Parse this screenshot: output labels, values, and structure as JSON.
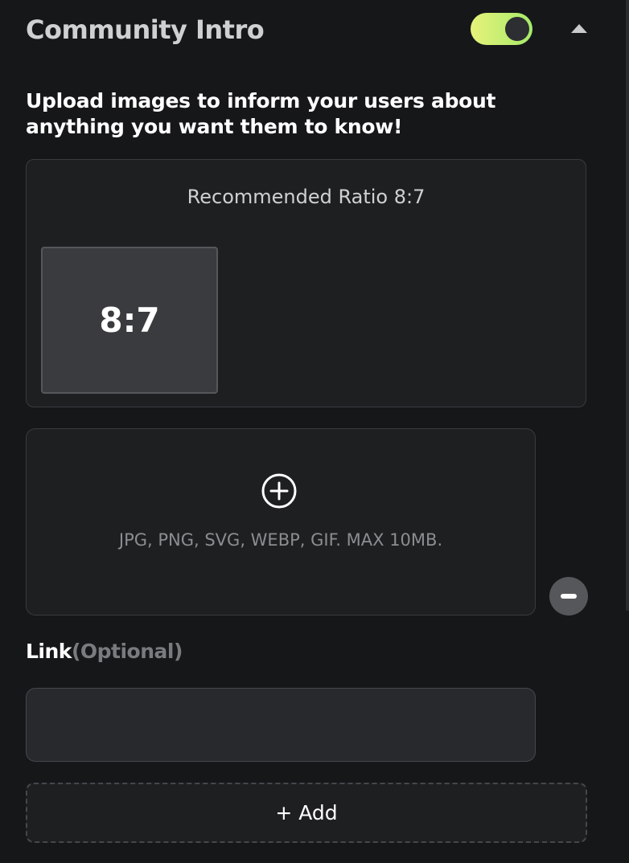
{
  "section": {
    "title": "Community Intro",
    "toggle_on": true,
    "collapse_icon": "caret-up-icon"
  },
  "description": "Upload images to inform your users about anything you want them to know!",
  "ratio": {
    "title": "Recommended Ratio 8:7",
    "sample_label": "8:7"
  },
  "upload": {
    "icon": "plus-circle-icon",
    "formats": "JPG, PNG, SVG, WEBP, GIF. MAX 10MB."
  },
  "remove_icon": "minus-circle-icon",
  "link": {
    "label": "Link",
    "optional": "(Optional)",
    "value": "",
    "placeholder": ""
  },
  "add_button": "+ Add",
  "colors": {
    "background": "#161719",
    "panel": "#1e1f21",
    "toggle_gradient_start": "#e7f27a",
    "toggle_gradient_end": "#a6ea6a"
  }
}
